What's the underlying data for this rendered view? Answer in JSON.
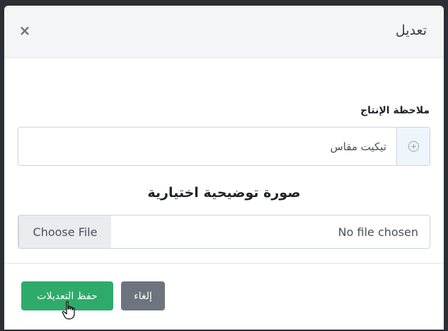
{
  "modal": {
    "title": "تعديل",
    "close_symbol": "×"
  },
  "form": {
    "note_label": "ملاحظة الإنتاج",
    "note_value": "تيكيت مقاس",
    "note_addon_icon": "plus-circle-icon",
    "image_heading": "صورة توضيحية اختيارية",
    "file_button_label": "Choose File",
    "file_status": "No file chosen"
  },
  "footer": {
    "save_label": "حفظ التعديلات",
    "cancel_label": "إلغاء"
  },
  "colors": {
    "save_button": "#2eab6b",
    "cancel_button": "#6c757d",
    "header_bg": "#f4f5f7"
  }
}
